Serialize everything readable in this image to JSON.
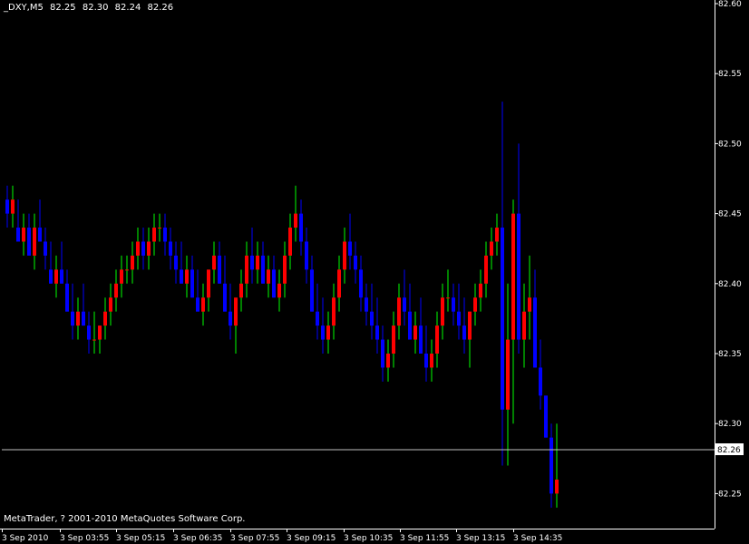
{
  "header": {
    "symbol": "_DXY,M5",
    "open": "82.25",
    "high": "82.30",
    "low": "82.24",
    "close": "82.26"
  },
  "copyright": "MetaTrader, ? 2001-2010 MetaQuotes Software Corp.",
  "colors": {
    "background": "#000000",
    "axis": "#ffffff",
    "bull_bar": "#00ff00",
    "bear_bar": "#0000ff",
    "bull_body": "#ff0000",
    "bear_body": "#0000ff",
    "last_price_line": "#c0c0c0"
  },
  "chart_data": {
    "type": "candlestick",
    "y_ticks": [
      "82.60",
      "82.55",
      "82.50",
      "82.45",
      "82.40",
      "82.35",
      "82.30",
      "82.25"
    ],
    "ylim": [
      82.225,
      82.6
    ],
    "x_ticks": [
      "3 Sep 2010",
      "3 Sep 03:55",
      "3 Sep 05:15",
      "3 Sep 06:35",
      "3 Sep 07:55",
      "3 Sep 09:15",
      "3 Sep 10:35",
      "3 Sep 11:55",
      "3 Sep 13:15",
      "3 Sep 14:35"
    ],
    "last_price": "82.26",
    "grid": false,
    "candles": [
      [
        82.46,
        82.47,
        82.44,
        82.45
      ],
      [
        82.45,
        82.47,
        82.44,
        82.46
      ],
      [
        82.44,
        82.46,
        82.43,
        82.43
      ],
      [
        82.43,
        82.45,
        82.42,
        82.44
      ],
      [
        82.44,
        82.45,
        82.42,
        82.42
      ],
      [
        82.42,
        82.45,
        82.41,
        82.44
      ],
      [
        82.44,
        82.46,
        82.43,
        82.43
      ],
      [
        82.43,
        82.44,
        82.41,
        82.42
      ],
      [
        82.41,
        82.43,
        82.4,
        82.4
      ],
      [
        82.4,
        82.42,
        82.39,
        82.41
      ],
      [
        82.41,
        82.43,
        82.4,
        82.4
      ],
      [
        82.4,
        82.41,
        82.38,
        82.38
      ],
      [
        82.38,
        82.4,
        82.36,
        82.37
      ],
      [
        82.37,
        82.39,
        82.36,
        82.38
      ],
      [
        82.38,
        82.4,
        82.37,
        82.37
      ],
      [
        82.37,
        82.38,
        82.35,
        82.36
      ],
      [
        82.36,
        82.38,
        82.35,
        82.36
      ],
      [
        82.36,
        82.37,
        82.35,
        82.37
      ],
      [
        82.37,
        82.39,
        82.36,
        82.38
      ],
      [
        82.38,
        82.4,
        82.37,
        82.39
      ],
      [
        82.39,
        82.41,
        82.38,
        82.4
      ],
      [
        82.4,
        82.42,
        82.39,
        82.41
      ],
      [
        82.41,
        82.42,
        82.4,
        82.41
      ],
      [
        82.41,
        82.43,
        82.4,
        82.42
      ],
      [
        82.42,
        82.44,
        82.41,
        82.43
      ],
      [
        82.43,
        82.44,
        82.41,
        82.42
      ],
      [
        82.42,
        82.44,
        82.41,
        82.43
      ],
      [
        82.43,
        82.45,
        82.42,
        82.44
      ],
      [
        82.44,
        82.45,
        82.43,
        82.44
      ],
      [
        82.44,
        82.45,
        82.42,
        82.43
      ],
      [
        82.43,
        82.44,
        82.41,
        82.42
      ],
      [
        82.42,
        82.43,
        82.4,
        82.41
      ],
      [
        82.41,
        82.43,
        82.4,
        82.4
      ],
      [
        82.4,
        82.42,
        82.39,
        82.41
      ],
      [
        82.41,
        82.42,
        82.39,
        82.39
      ],
      [
        82.39,
        82.41,
        82.38,
        82.38
      ],
      [
        82.38,
        82.4,
        82.37,
        82.39
      ],
      [
        82.39,
        82.41,
        82.38,
        82.41
      ],
      [
        82.41,
        82.43,
        82.4,
        82.42
      ],
      [
        82.42,
        82.43,
        82.4,
        82.4
      ],
      [
        82.4,
        82.42,
        82.38,
        82.38
      ],
      [
        82.38,
        82.4,
        82.36,
        82.37
      ],
      [
        82.37,
        82.39,
        82.35,
        82.39
      ],
      [
        82.39,
        82.41,
        82.38,
        82.4
      ],
      [
        82.4,
        82.43,
        82.39,
        82.42
      ],
      [
        82.42,
        82.44,
        82.4,
        82.41
      ],
      [
        82.41,
        82.43,
        82.4,
        82.42
      ],
      [
        82.42,
        82.43,
        82.4,
        82.4
      ],
      [
        82.4,
        82.42,
        82.39,
        82.41
      ],
      [
        82.41,
        82.42,
        82.39,
        82.39
      ],
      [
        82.39,
        82.41,
        82.38,
        82.4
      ],
      [
        82.4,
        82.43,
        82.39,
        82.42
      ],
      [
        82.42,
        82.45,
        82.41,
        82.44
      ],
      [
        82.44,
        82.47,
        82.43,
        82.45
      ],
      [
        82.45,
        82.46,
        82.42,
        82.43
      ],
      [
        82.43,
        82.44,
        82.4,
        82.41
      ],
      [
        82.41,
        82.42,
        82.38,
        82.38
      ],
      [
        82.38,
        82.4,
        82.36,
        82.37
      ],
      [
        82.37,
        82.39,
        82.35,
        82.36
      ],
      [
        82.36,
        82.38,
        82.35,
        82.37
      ],
      [
        82.37,
        82.4,
        82.36,
        82.39
      ],
      [
        82.39,
        82.42,
        82.38,
        82.41
      ],
      [
        82.41,
        82.44,
        82.4,
        82.43
      ],
      [
        82.43,
        82.45,
        82.41,
        82.42
      ],
      [
        82.42,
        82.43,
        82.4,
        82.41
      ],
      [
        82.41,
        82.42,
        82.38,
        82.39
      ],
      [
        82.39,
        82.4,
        82.37,
        82.38
      ],
      [
        82.38,
        82.4,
        82.36,
        82.37
      ],
      [
        82.37,
        82.39,
        82.35,
        82.36
      ],
      [
        82.36,
        82.37,
        82.33,
        82.34
      ],
      [
        82.34,
        82.36,
        82.33,
        82.35
      ],
      [
        82.35,
        82.38,
        82.34,
        82.37
      ],
      [
        82.37,
        82.4,
        82.36,
        82.39
      ],
      [
        82.39,
        82.41,
        82.37,
        82.38
      ],
      [
        82.38,
        82.4,
        82.36,
        82.36
      ],
      [
        82.36,
        82.38,
        82.35,
        82.37
      ],
      [
        82.37,
        82.39,
        82.35,
        82.35
      ],
      [
        82.35,
        82.37,
        82.33,
        82.34
      ],
      [
        82.34,
        82.36,
        82.33,
        82.35
      ],
      [
        82.35,
        82.38,
        82.34,
        82.37
      ],
      [
        82.37,
        82.4,
        82.36,
        82.39
      ],
      [
        82.39,
        82.41,
        82.38,
        82.39
      ],
      [
        82.39,
        82.4,
        82.37,
        82.38
      ],
      [
        82.38,
        82.4,
        82.36,
        82.37
      ],
      [
        82.37,
        82.39,
        82.35,
        82.36
      ],
      [
        82.36,
        82.38,
        82.34,
        82.38
      ],
      [
        82.38,
        82.4,
        82.37,
        82.39
      ],
      [
        82.39,
        82.41,
        82.38,
        82.4
      ],
      [
        82.4,
        82.43,
        82.39,
        82.42
      ],
      [
        82.42,
        82.44,
        82.41,
        82.43
      ],
      [
        82.43,
        82.45,
        82.42,
        82.44
      ],
      [
        82.44,
        82.53,
        82.27,
        82.31
      ],
      [
        82.31,
        82.4,
        82.27,
        82.36
      ],
      [
        82.36,
        82.46,
        82.3,
        82.45
      ],
      [
        82.45,
        82.5,
        82.35,
        82.36
      ],
      [
        82.36,
        82.4,
        82.34,
        82.38
      ],
      [
        82.38,
        82.42,
        82.36,
        82.39
      ],
      [
        82.39,
        82.41,
        82.34,
        82.34
      ],
      [
        82.34,
        82.36,
        82.31,
        82.32
      ],
      [
        82.32,
        82.32,
        82.29,
        82.29
      ],
      [
        82.29,
        82.3,
        82.24,
        82.25
      ],
      [
        82.25,
        82.3,
        82.24,
        82.26
      ]
    ]
  }
}
